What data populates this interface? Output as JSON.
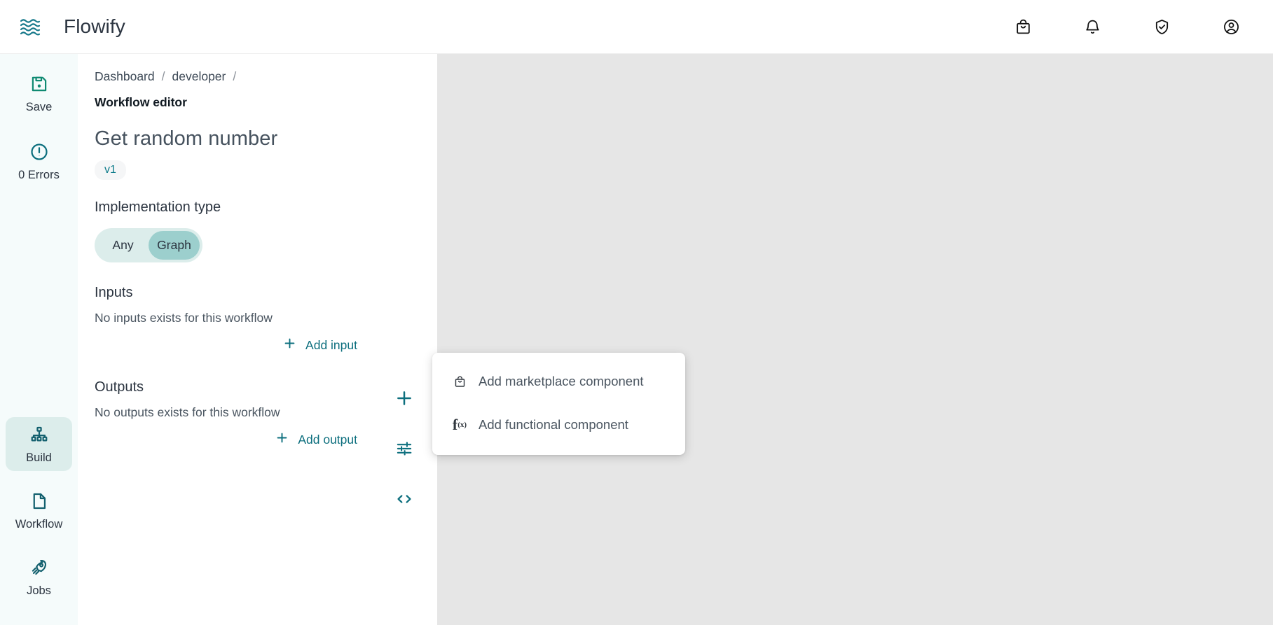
{
  "header": {
    "logo_icon": "waves-logo-icon",
    "brand": "Flowify",
    "actions": [
      {
        "name": "marketplace-icon",
        "icon": "shopping-bag"
      },
      {
        "name": "notifications-icon",
        "icon": "bell"
      },
      {
        "name": "security-icon",
        "icon": "shield-check"
      },
      {
        "name": "account-icon",
        "icon": "user-circle"
      }
    ]
  },
  "rail": {
    "top_items": [
      {
        "label": "Save",
        "icon": "floppy-disk",
        "name": "save"
      },
      {
        "label": "0 Errors",
        "icon": "exclamation-circle",
        "name": "errors"
      }
    ],
    "bottom_items": [
      {
        "label": "Build",
        "icon": "hierarchy",
        "name": "build",
        "selected": true
      },
      {
        "label": "Workflow",
        "icon": "document",
        "name": "workflow",
        "selected": false
      },
      {
        "label": "Jobs",
        "icon": "rocket",
        "name": "jobs",
        "selected": false
      }
    ]
  },
  "panel": {
    "breadcrumb": {
      "items": [
        "Dashboard",
        "developer"
      ],
      "separator": "/",
      "current": "Workflow editor"
    },
    "workflow_title": "Get random number",
    "version": "v1",
    "implementation": {
      "label": "Implementation type",
      "options": [
        "Any",
        "Graph"
      ],
      "selected": "Graph"
    },
    "inputs": {
      "heading": "Inputs",
      "empty_text": "No inputs exists for this workflow",
      "add_label": "Add input"
    },
    "outputs": {
      "heading": "Outputs",
      "empty_text": "No outputs exists for this workflow",
      "add_label": "Add output"
    }
  },
  "canvas": {
    "background": "#e6e6e6",
    "tools": [
      {
        "name": "add-component-button",
        "icon": "plus"
      },
      {
        "name": "canvas-settings-button",
        "icon": "sliders"
      },
      {
        "name": "code-view-button",
        "icon": "code-brackets"
      }
    ]
  },
  "add_menu": {
    "items": [
      {
        "label": "Add marketplace component",
        "icon": "shopping-bag",
        "name": "add-marketplace-component"
      },
      {
        "label": "Add functional component",
        "icon": "f-of-x",
        "name": "add-functional-component"
      }
    ]
  },
  "colors": {
    "teal": "#0d6f7e",
    "accent_green": "#0f8a72",
    "rail_bg": "#f5fbfb",
    "selected_bg": "#dcedeb",
    "toggle_active": "#9ccfcd",
    "canvas": "#e6e6e6"
  }
}
